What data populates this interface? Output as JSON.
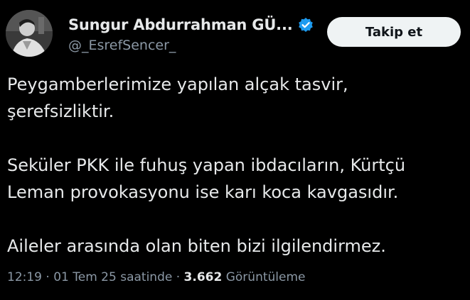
{
  "tweet": {
    "author": {
      "display_name": "Sungur Abdurrahman GÜ...",
      "handle": "@_EsrefSencer_",
      "verified": true,
      "avatar_icon": "profile-avatar"
    },
    "follow_button_label": "Takip et",
    "paragraphs": [
      {
        "lines": [
          "Peygamberlerimize yapılan alçak tasvir,",
          "şerefsizliktir."
        ]
      },
      {
        "lines": [
          "Seküler PKK ile fuhuş yapan ibdacıların, Kürtçü",
          "Leman provokasyonu ise karı koca kavgasıdır."
        ]
      },
      {
        "lines": [
          "Aileler arasında olan biten bizi ilgilendirmez."
        ]
      }
    ],
    "meta": {
      "time": "12:19",
      "separator": " · ",
      "date": "01 Tem 25 saatinde",
      "views_count": "3.662",
      "views_label": "Görüntüleme"
    }
  },
  "colors": {
    "background": "#000000",
    "text_primary": "#e7e9ea",
    "text_secondary": "#8b98a5",
    "verified_badge": "#1d9bf0",
    "follow_button_bg": "#eff3f4",
    "follow_button_text": "#0f1419"
  }
}
